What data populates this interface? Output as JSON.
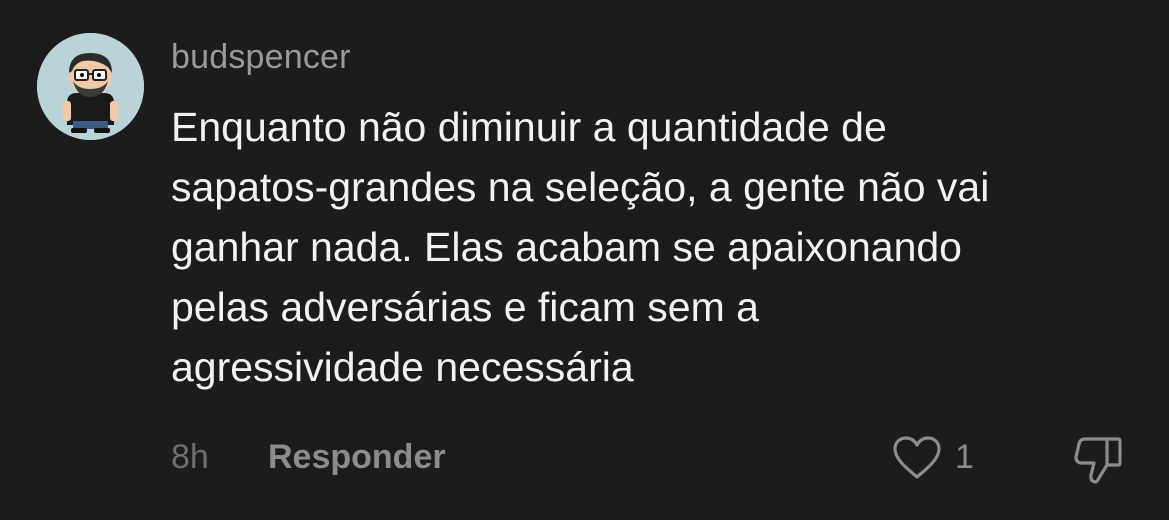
{
  "comment": {
    "username": "budspencer",
    "avatar_icon": "cartoon-man-with-glasses-avatar",
    "text_lines": [
      "Enquanto não diminuir a quantidade de",
      "sapatos-grandes na seleção, a gente não vai",
      "ganhar nada. Elas acabam se apaixonando",
      "pelas adversárias e ficam sem a",
      "agressividade necessária"
    ],
    "time": "8h",
    "reply_label": "Responder",
    "like_icon": "heart-icon",
    "like_count": "1",
    "dislike_icon": "thumbs-down-icon"
  },
  "colors": {
    "background": "#1c1c1c",
    "text": "#f2f2f2",
    "muted": "#8c8c8c"
  }
}
